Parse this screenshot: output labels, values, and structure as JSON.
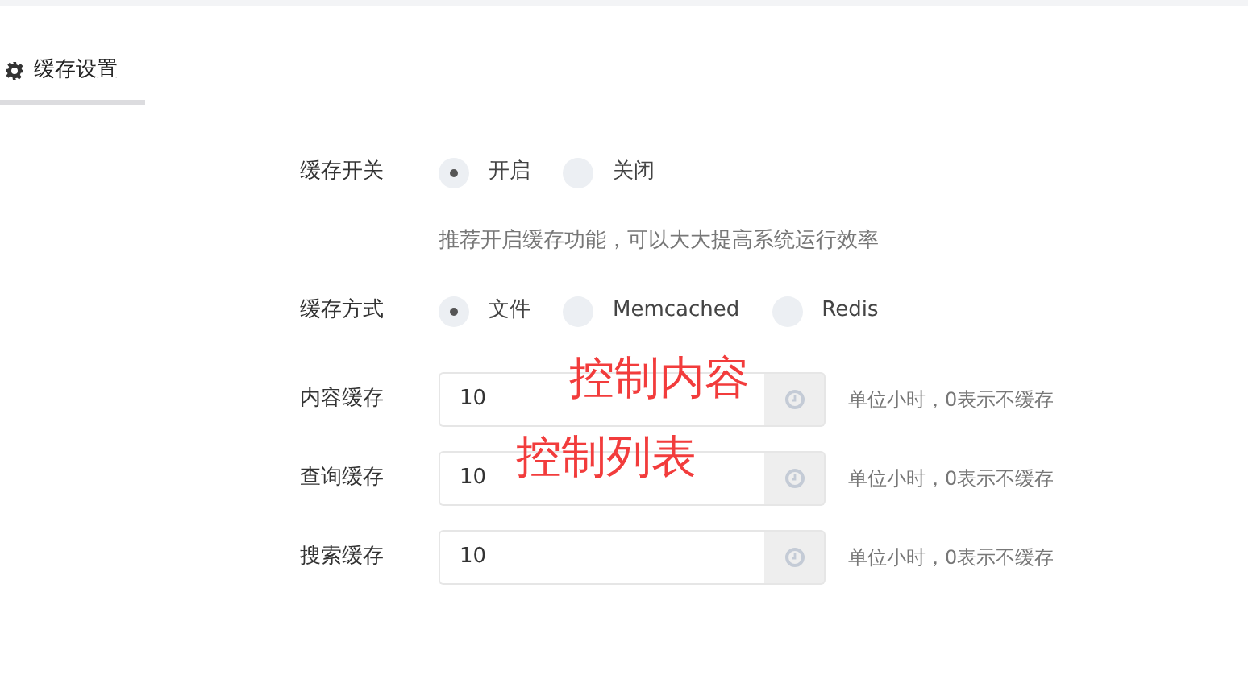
{
  "tabs": [
    {
      "label": "缓存设置",
      "selected": true
    }
  ],
  "form": [
    {
      "kind": "radio",
      "label": "缓存开关",
      "options": [
        {
          "label": "开启",
          "selected": true
        },
        {
          "label": "关闭",
          "selected": false
        }
      ]
    },
    {
      "kind": "hint",
      "text": "推荐开启缓存功能，可以大大提高系统运行效率"
    },
    {
      "kind": "radio",
      "label": "缓存方式",
      "options": [
        {
          "label": "文件",
          "selected": true
        },
        {
          "label": "Memcached",
          "selected": false
        },
        {
          "label": "Redis",
          "selected": false
        }
      ]
    },
    {
      "kind": "input",
      "label": "内容缓存",
      "value": "10",
      "help": "单位小时，0表示不缓存",
      "annotation": "控制内容"
    },
    {
      "kind": "input",
      "label": "查询缓存",
      "value": "10",
      "help": "单位小时，0表示不缓存",
      "annotation": "控制列表"
    },
    {
      "kind": "input",
      "label": "搜索缓存",
      "value": "10",
      "help": "单位小时，0表示不缓存"
    }
  ]
}
